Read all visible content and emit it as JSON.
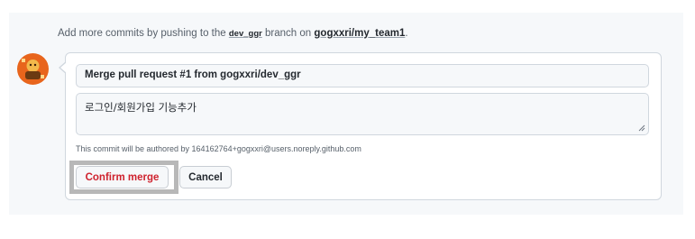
{
  "hint": {
    "prefix": "Add more commits by pushing to the",
    "branch": "dev_ggr",
    "middle": "branch on",
    "repo": "gogxxri/my_team1",
    "suffix": "."
  },
  "merge_form": {
    "title_value": "Merge pull request #1 from gogxxri/dev_ggr",
    "body_value": "로그인/회원가입 기능추가",
    "author_note": "This commit will be authored by 164162764+gogxxri@users.noreply.github.com"
  },
  "buttons": {
    "confirm_label": "Confirm merge",
    "cancel_label": "Cancel"
  },
  "colors": {
    "danger": "#cf222e",
    "border": "#d0d7de",
    "focus_frame": "#b8b8b8",
    "avatar_bg": "#e8651c"
  },
  "icons": {
    "avatar": "user-avatar-icon",
    "resize": "resize-grip-icon"
  }
}
